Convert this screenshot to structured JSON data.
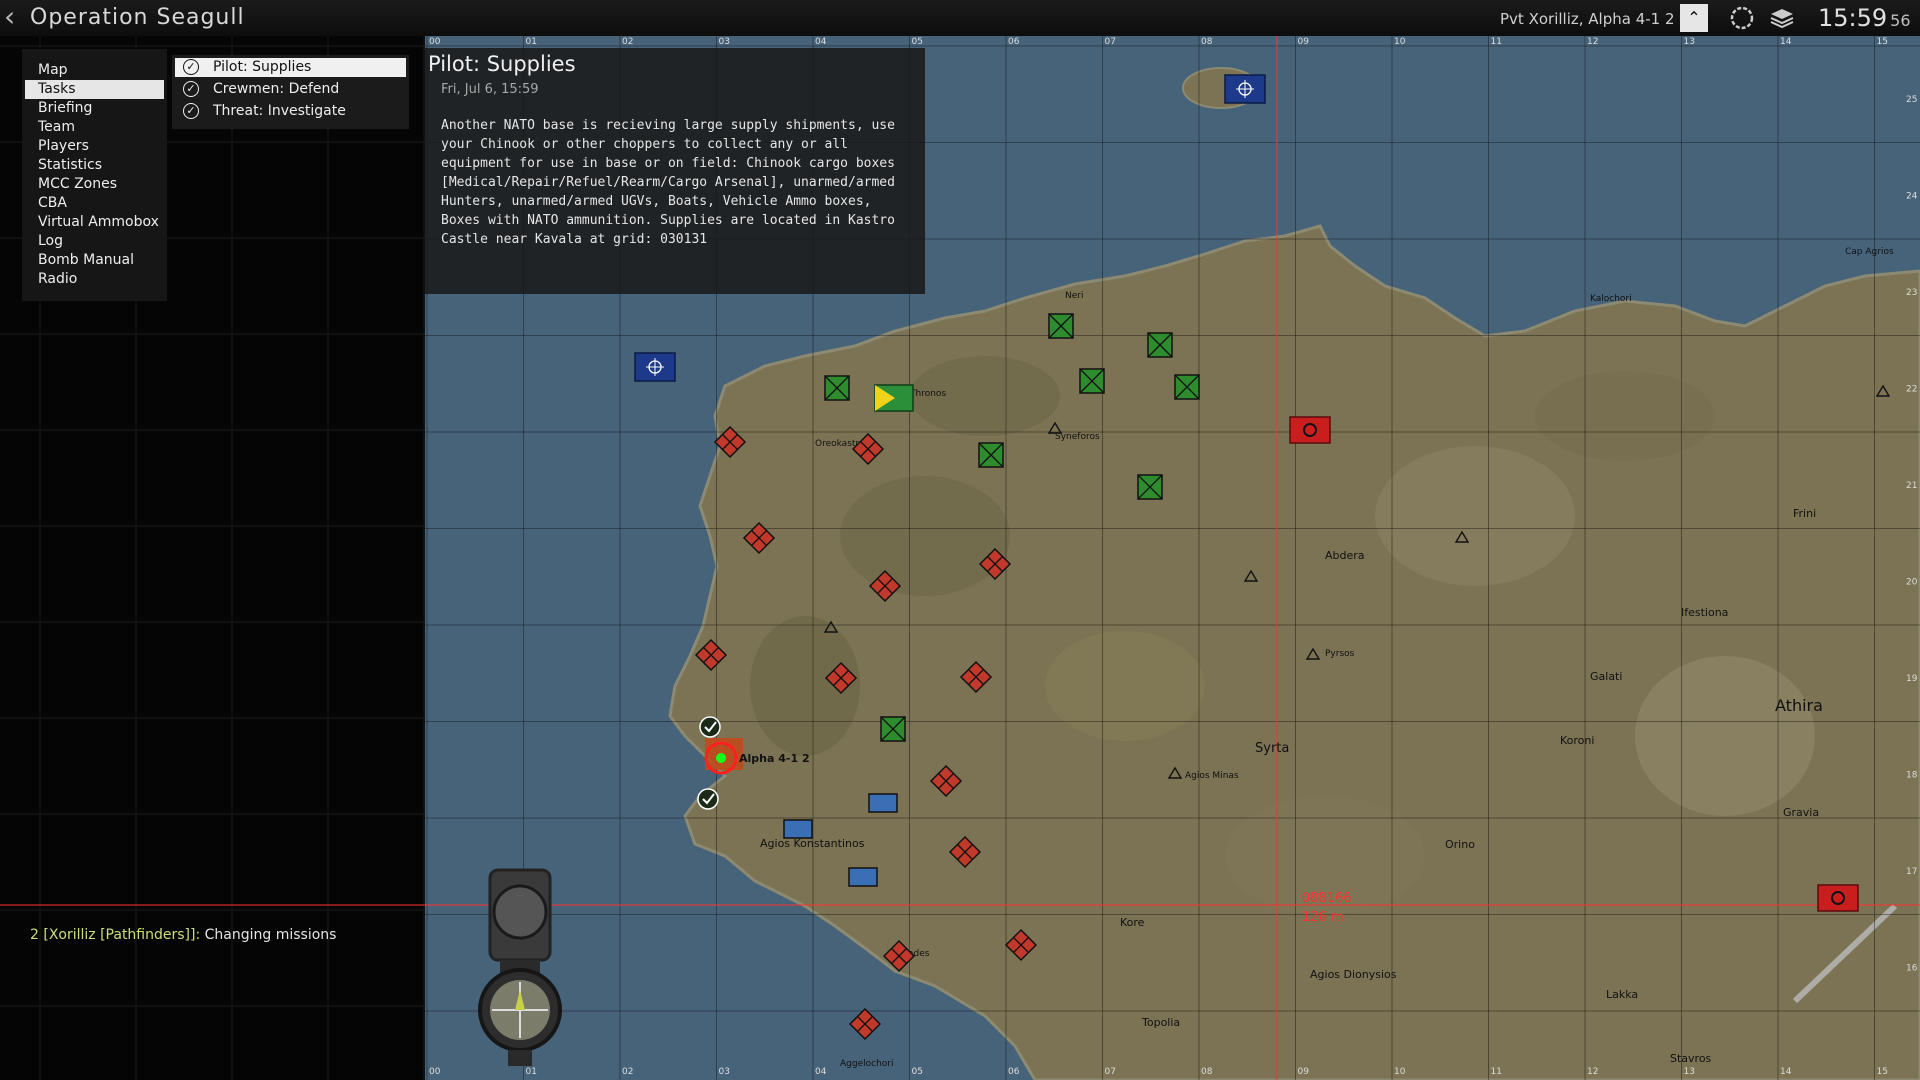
{
  "topbar": {
    "back_icon": "chevron-left-icon",
    "title": "Operation Seagull",
    "player": "Pvt Xorilliz, Alpha 4-1 2",
    "clock_hm": "15:59",
    "clock_s": "56"
  },
  "menu": {
    "items": [
      {
        "label": "Map"
      },
      {
        "label": "Tasks"
      },
      {
        "label": "Briefing"
      },
      {
        "label": "Team"
      },
      {
        "label": "Players"
      },
      {
        "label": "Statistics"
      },
      {
        "label": "MCC Zones"
      },
      {
        "label": "CBA"
      },
      {
        "label": "Virtual Ammobox"
      },
      {
        "label": "Log"
      },
      {
        "label": "Bomb Manual"
      },
      {
        "label": "Radio"
      }
    ],
    "active": "Tasks"
  },
  "tasks": {
    "items": [
      {
        "label": "Pilot: Supplies"
      },
      {
        "label": "Crewmen: Defend"
      },
      {
        "label": "Threat: Investigate"
      }
    ],
    "active": "Pilot: Supplies"
  },
  "description": {
    "title": "Pilot: Supplies",
    "date": "Fri, Jul 6,   15:59",
    "lines": [
      "Another NATO base is recieving large supply shipments, use",
      "your Chinook or other choppers to collect any or all",
      "equipment for use in base or on field: Chinook cargo boxes",
      "[Medical/Repair/Refuel/Rearm/Cargo Arsenal], unarmed/armed",
      "Hunters, unarmed/armed UGVs, Boats, Vehicle Ammo boxes,",
      "Boxes with NATO ammunition. Supplies are located in Kastro",
      "Castle near Kavala at grid: 030131"
    ]
  },
  "map": {
    "grid_x_labels": [
      "00",
      "01",
      "02",
      "03",
      "04",
      "05",
      "06",
      "07",
      "08",
      "09",
      "10",
      "11",
      "12",
      "13",
      "14",
      "15"
    ],
    "grid_y_labels": [
      "25",
      "24",
      "23",
      "22",
      "21",
      "20",
      "19",
      "18",
      "17",
      "16"
    ],
    "towns": [
      {
        "name": "Athira"
      },
      {
        "name": "Syrta"
      },
      {
        "name": "Agios Konstantinos"
      },
      {
        "name": "Abdera"
      },
      {
        "name": "Galati"
      },
      {
        "name": "Ifestiona"
      },
      {
        "name": "Frini"
      },
      {
        "name": "Koroni"
      },
      {
        "name": "Gravia"
      },
      {
        "name": "Orino"
      },
      {
        "name": "Kore"
      },
      {
        "name": "Agios Dionysios"
      },
      {
        "name": "Lakka"
      },
      {
        "name": "Topolia"
      },
      {
        "name": "Stavros"
      },
      {
        "name": "Agios Minas"
      },
      {
        "name": "Pyrsos"
      },
      {
        "name": "Syneforos"
      },
      {
        "name": "Oreokastro"
      },
      {
        "name": "Negades"
      },
      {
        "name": "Aggelochori"
      },
      {
        "name": "Cap Agrios"
      },
      {
        "name": "Kalochori"
      },
      {
        "name": "Thronos"
      },
      {
        "name": "Neri"
      }
    ],
    "cursor_grid": "088166",
    "cursor_distance": "126 m",
    "unit_label": "Alpha 4-1 2"
  },
  "chat": {
    "sender": "2 [Xorilliz [Pathfinders]]:",
    "message": "Changing missions"
  },
  "colors": {
    "hostile": "#c0392b",
    "independent": "#2e8b2e",
    "friendly": "#2c5fb3",
    "cursor": "#ff3030",
    "menu_active": "#e6e6e6"
  },
  "icons": [
    "chevron-up-icon",
    "sync-icon",
    "layers-icon",
    "checkmark-icon",
    "compass-icon"
  ]
}
